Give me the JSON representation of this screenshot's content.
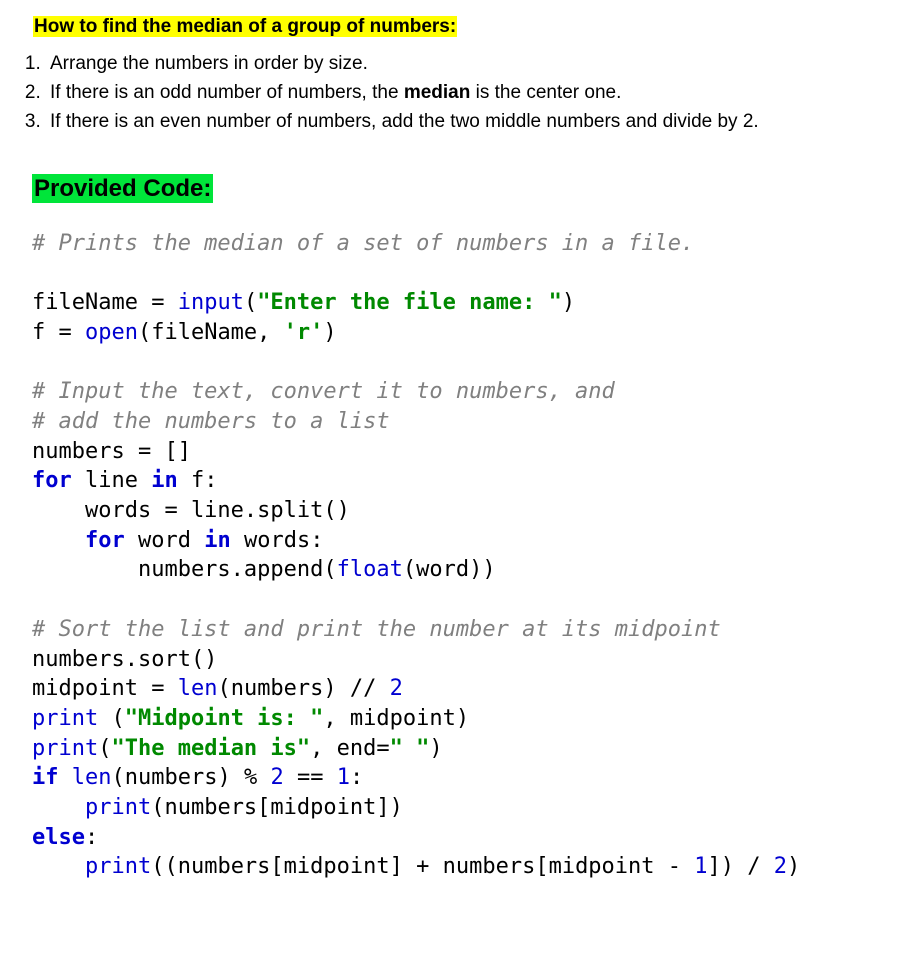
{
  "heading": "How to find the median of a group of numbers:",
  "steps": [
    {
      "before": "Arrange the numbers in order by size.",
      "bold": "",
      "after": ""
    },
    {
      "before": "If there is an odd number of numbers, the ",
      "bold": "median",
      "after": " is the center one."
    },
    {
      "before": "If there is an even number of numbers, add the two middle numbers and divide by 2.",
      "bold": "",
      "after": ""
    }
  ],
  "section_title": "Provided Code:",
  "code": {
    "cm1": "# Prints the median of a set of numbers in a file.",
    "l1_a": "fileName = ",
    "l1_fn": "input",
    "l1_b": "(",
    "l1_str": "\"Enter the file name: \"",
    "l1_c": ")",
    "l2_a": "f = ",
    "l2_fn": "open",
    "l2_b": "(fileName, ",
    "l2_str": "'r'",
    "l2_c": ")",
    "cm2": "# Input the text, convert it to numbers, and",
    "cm3": "# add the numbers to a list",
    "l3": "numbers = []",
    "l4_kw": "for",
    "l4_a": " line ",
    "l4_kw2": "in",
    "l4_b": " f:",
    "l5": "    words = line.split()",
    "l6_pad": "    ",
    "l6_kw": "for",
    "l6_a": " word ",
    "l6_kw2": "in",
    "l6_b": " words:",
    "l7_a": "        numbers.append(",
    "l7_fn": "float",
    "l7_b": "(word))",
    "cm4": "# Sort the list and print the number at its midpoint",
    "l8": "numbers.sort()",
    "l9_a": "midpoint = ",
    "l9_fn": "len",
    "l9_b": "(numbers) // ",
    "l9_n": "2",
    "l10_fn": "print",
    "l10_a": " (",
    "l10_str": "\"Midpoint is: \"",
    "l10_b": ", midpoint)",
    "l11_fn": "print",
    "l11_a": "(",
    "l11_str": "\"The median is\"",
    "l11_b": ", end=",
    "l11_str2": "\" \"",
    "l11_c": ")",
    "l12_kw": "if",
    "l12_a": " ",
    "l12_fn": "len",
    "l12_b": "(numbers) % ",
    "l12_n1": "2",
    "l12_c": " == ",
    "l12_n2": "1",
    "l12_d": ":",
    "l13_pad": "    ",
    "l13_fn": "print",
    "l13_a": "(numbers[midpoint])",
    "l14_kw": "else",
    "l14_a": ":",
    "l15_pad": "    ",
    "l15_fn": "print",
    "l15_a": "((numbers[midpoint] + numbers[midpoint - ",
    "l15_n": "1",
    "l15_b": "]) / ",
    "l15_n2": "2",
    "l15_c": ")"
  }
}
